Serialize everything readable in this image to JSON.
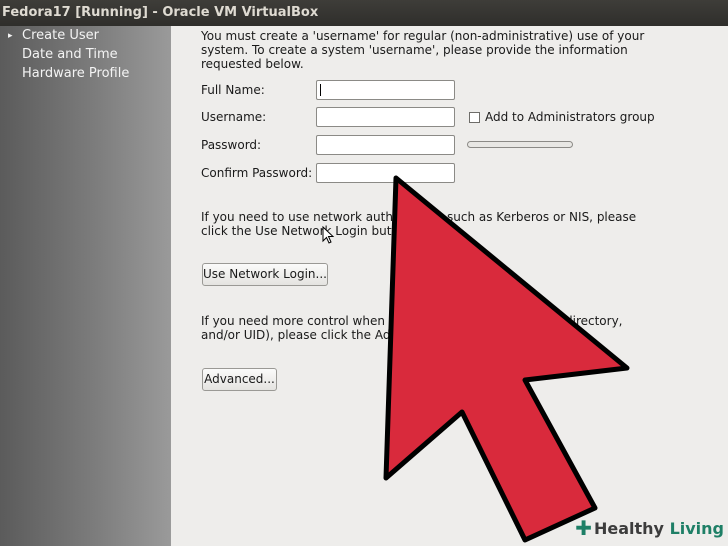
{
  "window": {
    "title": "Fedora17 [Running] - Oracle VM VirtualBox"
  },
  "sidebar": {
    "items": [
      {
        "label": "Create User",
        "active": true
      },
      {
        "label": "Date and Time",
        "active": false
      },
      {
        "label": "Hardware Profile",
        "active": false
      }
    ]
  },
  "form": {
    "intro": [
      "You must create a 'username' for regular (non-administrative) use of your",
      "system.  To create a system 'username', please provide the information",
      "requested below."
    ],
    "full_name": {
      "label": "Full Name:",
      "value": ""
    },
    "username": {
      "label": "Username:",
      "value": ""
    },
    "password": {
      "label": "Password:",
      "value": ""
    },
    "confirm_password": {
      "label": "Confirm Password:",
      "value": ""
    },
    "admin_checkbox": {
      "label": "Add to Administrators group",
      "checked": false
    },
    "network_text": [
      "If you need to use network authen",
      "such as Kerberos or NIS, please",
      "click the Use Network Login butto"
    ],
    "network_button": "Use Network Login...",
    "control_text": [
      "If you need more control when crea",
      "directory,",
      "and/or UID), please click the Adva"
    ],
    "advanced_button": "Advanced..."
  },
  "overlay": {
    "arrow_color": "#d92a3c",
    "arrow_outline": "#000000",
    "watermark": {
      "brand": "Healthy",
      "tag": "Living",
      "icon": "plus-icon"
    }
  }
}
